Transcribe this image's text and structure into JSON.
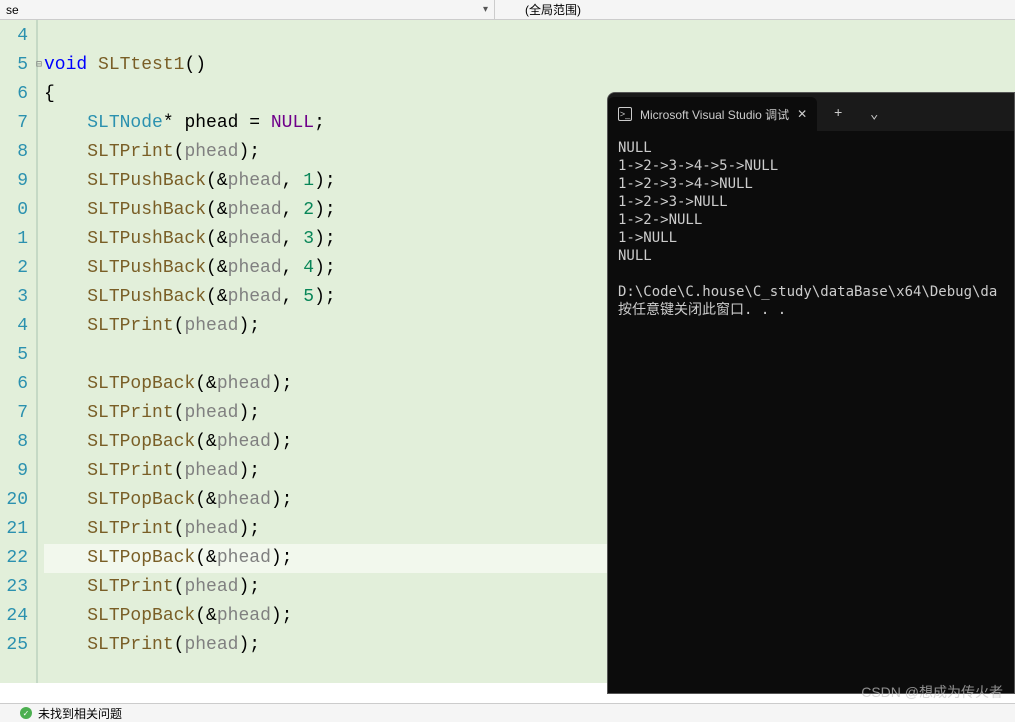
{
  "topbar": {
    "left_text": "se",
    "right_text": "(全局范围)"
  },
  "gutter": [
    "4",
    "5",
    "6",
    "7",
    "8",
    "9",
    "0",
    "1",
    "2",
    "3",
    "4",
    "5",
    "6",
    "7",
    "8",
    "9",
    "20",
    "21",
    "22",
    "23",
    "24",
    "25"
  ],
  "code": [
    {
      "tokens": [
        {
          "t": "plain",
          "v": ""
        }
      ]
    },
    {
      "tokens": [
        {
          "t": "keyword",
          "v": "void"
        },
        {
          "t": "plain",
          "v": " "
        },
        {
          "t": "func",
          "v": "SLTtest1"
        },
        {
          "t": "plain",
          "v": "()"
        }
      ],
      "collapse": true
    },
    {
      "tokens": [
        {
          "t": "plain",
          "v": "{"
        }
      ]
    },
    {
      "tokens": [
        {
          "t": "plain",
          "v": "    "
        },
        {
          "t": "type",
          "v": "SLTNode"
        },
        {
          "t": "plain",
          "v": "* phead = "
        },
        {
          "t": "null-kw",
          "v": "NULL"
        },
        {
          "t": "plain",
          "v": ";"
        }
      ]
    },
    {
      "tokens": [
        {
          "t": "plain",
          "v": "    "
        },
        {
          "t": "func",
          "v": "SLTPrint"
        },
        {
          "t": "plain",
          "v": "("
        },
        {
          "t": "var",
          "v": "phead"
        },
        {
          "t": "plain",
          "v": ");"
        }
      ]
    },
    {
      "tokens": [
        {
          "t": "plain",
          "v": "    "
        },
        {
          "t": "func",
          "v": "SLTPushBack"
        },
        {
          "t": "plain",
          "v": "(&"
        },
        {
          "t": "var",
          "v": "phead"
        },
        {
          "t": "plain",
          "v": ", "
        },
        {
          "t": "num",
          "v": "1"
        },
        {
          "t": "plain",
          "v": ");"
        }
      ]
    },
    {
      "tokens": [
        {
          "t": "plain",
          "v": "    "
        },
        {
          "t": "func",
          "v": "SLTPushBack"
        },
        {
          "t": "plain",
          "v": "(&"
        },
        {
          "t": "var",
          "v": "phead"
        },
        {
          "t": "plain",
          "v": ", "
        },
        {
          "t": "num",
          "v": "2"
        },
        {
          "t": "plain",
          "v": ");"
        }
      ]
    },
    {
      "tokens": [
        {
          "t": "plain",
          "v": "    "
        },
        {
          "t": "func",
          "v": "SLTPushBack"
        },
        {
          "t": "plain",
          "v": "(&"
        },
        {
          "t": "var",
          "v": "phead"
        },
        {
          "t": "plain",
          "v": ", "
        },
        {
          "t": "num",
          "v": "3"
        },
        {
          "t": "plain",
          "v": ");"
        }
      ]
    },
    {
      "tokens": [
        {
          "t": "plain",
          "v": "    "
        },
        {
          "t": "func",
          "v": "SLTPushBack"
        },
        {
          "t": "plain",
          "v": "(&"
        },
        {
          "t": "var",
          "v": "phead"
        },
        {
          "t": "plain",
          "v": ", "
        },
        {
          "t": "num",
          "v": "4"
        },
        {
          "t": "plain",
          "v": ");"
        }
      ]
    },
    {
      "tokens": [
        {
          "t": "plain",
          "v": "    "
        },
        {
          "t": "func",
          "v": "SLTPushBack"
        },
        {
          "t": "plain",
          "v": "(&"
        },
        {
          "t": "var",
          "v": "phead"
        },
        {
          "t": "plain",
          "v": ", "
        },
        {
          "t": "num",
          "v": "5"
        },
        {
          "t": "plain",
          "v": ");"
        }
      ]
    },
    {
      "tokens": [
        {
          "t": "plain",
          "v": "    "
        },
        {
          "t": "func",
          "v": "SLTPrint"
        },
        {
          "t": "plain",
          "v": "("
        },
        {
          "t": "var",
          "v": "phead"
        },
        {
          "t": "plain",
          "v": ");"
        }
      ]
    },
    {
      "tokens": [
        {
          "t": "plain",
          "v": ""
        }
      ]
    },
    {
      "tokens": [
        {
          "t": "plain",
          "v": "    "
        },
        {
          "t": "func",
          "v": "SLTPopBack"
        },
        {
          "t": "plain",
          "v": "(&"
        },
        {
          "t": "var",
          "v": "phead"
        },
        {
          "t": "plain",
          "v": ");"
        }
      ]
    },
    {
      "tokens": [
        {
          "t": "plain",
          "v": "    "
        },
        {
          "t": "func",
          "v": "SLTPrint"
        },
        {
          "t": "plain",
          "v": "("
        },
        {
          "t": "var",
          "v": "phead"
        },
        {
          "t": "plain",
          "v": ");"
        }
      ]
    },
    {
      "tokens": [
        {
          "t": "plain",
          "v": "    "
        },
        {
          "t": "func",
          "v": "SLTPopBack"
        },
        {
          "t": "plain",
          "v": "(&"
        },
        {
          "t": "var",
          "v": "phead"
        },
        {
          "t": "plain",
          "v": ");"
        }
      ]
    },
    {
      "tokens": [
        {
          "t": "plain",
          "v": "    "
        },
        {
          "t": "func",
          "v": "SLTPrint"
        },
        {
          "t": "plain",
          "v": "("
        },
        {
          "t": "var",
          "v": "phead"
        },
        {
          "t": "plain",
          "v": ");"
        }
      ]
    },
    {
      "tokens": [
        {
          "t": "plain",
          "v": "    "
        },
        {
          "t": "func",
          "v": "SLTPopBack"
        },
        {
          "t": "plain",
          "v": "(&"
        },
        {
          "t": "var",
          "v": "phead"
        },
        {
          "t": "plain",
          "v": ");"
        }
      ]
    },
    {
      "tokens": [
        {
          "t": "plain",
          "v": "    "
        },
        {
          "t": "func",
          "v": "SLTPrint"
        },
        {
          "t": "plain",
          "v": "("
        },
        {
          "t": "var",
          "v": "phead"
        },
        {
          "t": "plain",
          "v": ");"
        }
      ]
    },
    {
      "tokens": [
        {
          "t": "plain",
          "v": "    "
        },
        {
          "t": "func",
          "v": "SLTPopBack"
        },
        {
          "t": "plain",
          "v": "(&"
        },
        {
          "t": "var",
          "v": "phead"
        },
        {
          "t": "plain",
          "v": ");"
        }
      ],
      "hl": true
    },
    {
      "tokens": [
        {
          "t": "plain",
          "v": "    "
        },
        {
          "t": "func",
          "v": "SLTPrint"
        },
        {
          "t": "plain",
          "v": "("
        },
        {
          "t": "var",
          "v": "phead"
        },
        {
          "t": "plain",
          "v": ");"
        }
      ]
    },
    {
      "tokens": [
        {
          "t": "plain",
          "v": "    "
        },
        {
          "t": "func",
          "v": "SLTPopBack"
        },
        {
          "t": "plain",
          "v": "(&"
        },
        {
          "t": "var",
          "v": "phead"
        },
        {
          "t": "plain",
          "v": ");"
        }
      ]
    },
    {
      "tokens": [
        {
          "t": "plain",
          "v": "    "
        },
        {
          "t": "func",
          "v": "SLTPrint"
        },
        {
          "t": "plain",
          "v": "("
        },
        {
          "t": "var",
          "v": "phead"
        },
        {
          "t": "plain",
          "v": ");"
        }
      ]
    }
  ],
  "terminal": {
    "tab_title": "Microsoft Visual Studio 调试",
    "output": [
      "NULL",
      "1->2->3->4->5->NULL",
      "1->2->3->4->NULL",
      "1->2->3->NULL",
      "1->2->NULL",
      "1->NULL",
      "NULL",
      "",
      "D:\\Code\\C.house\\C_study\\dataBase\\x64\\Debug\\da",
      "按任意键关闭此窗口. . ."
    ]
  },
  "statusbar": {
    "text": "未找到相关问题"
  },
  "watermark": "CSDN @想成为传火者"
}
